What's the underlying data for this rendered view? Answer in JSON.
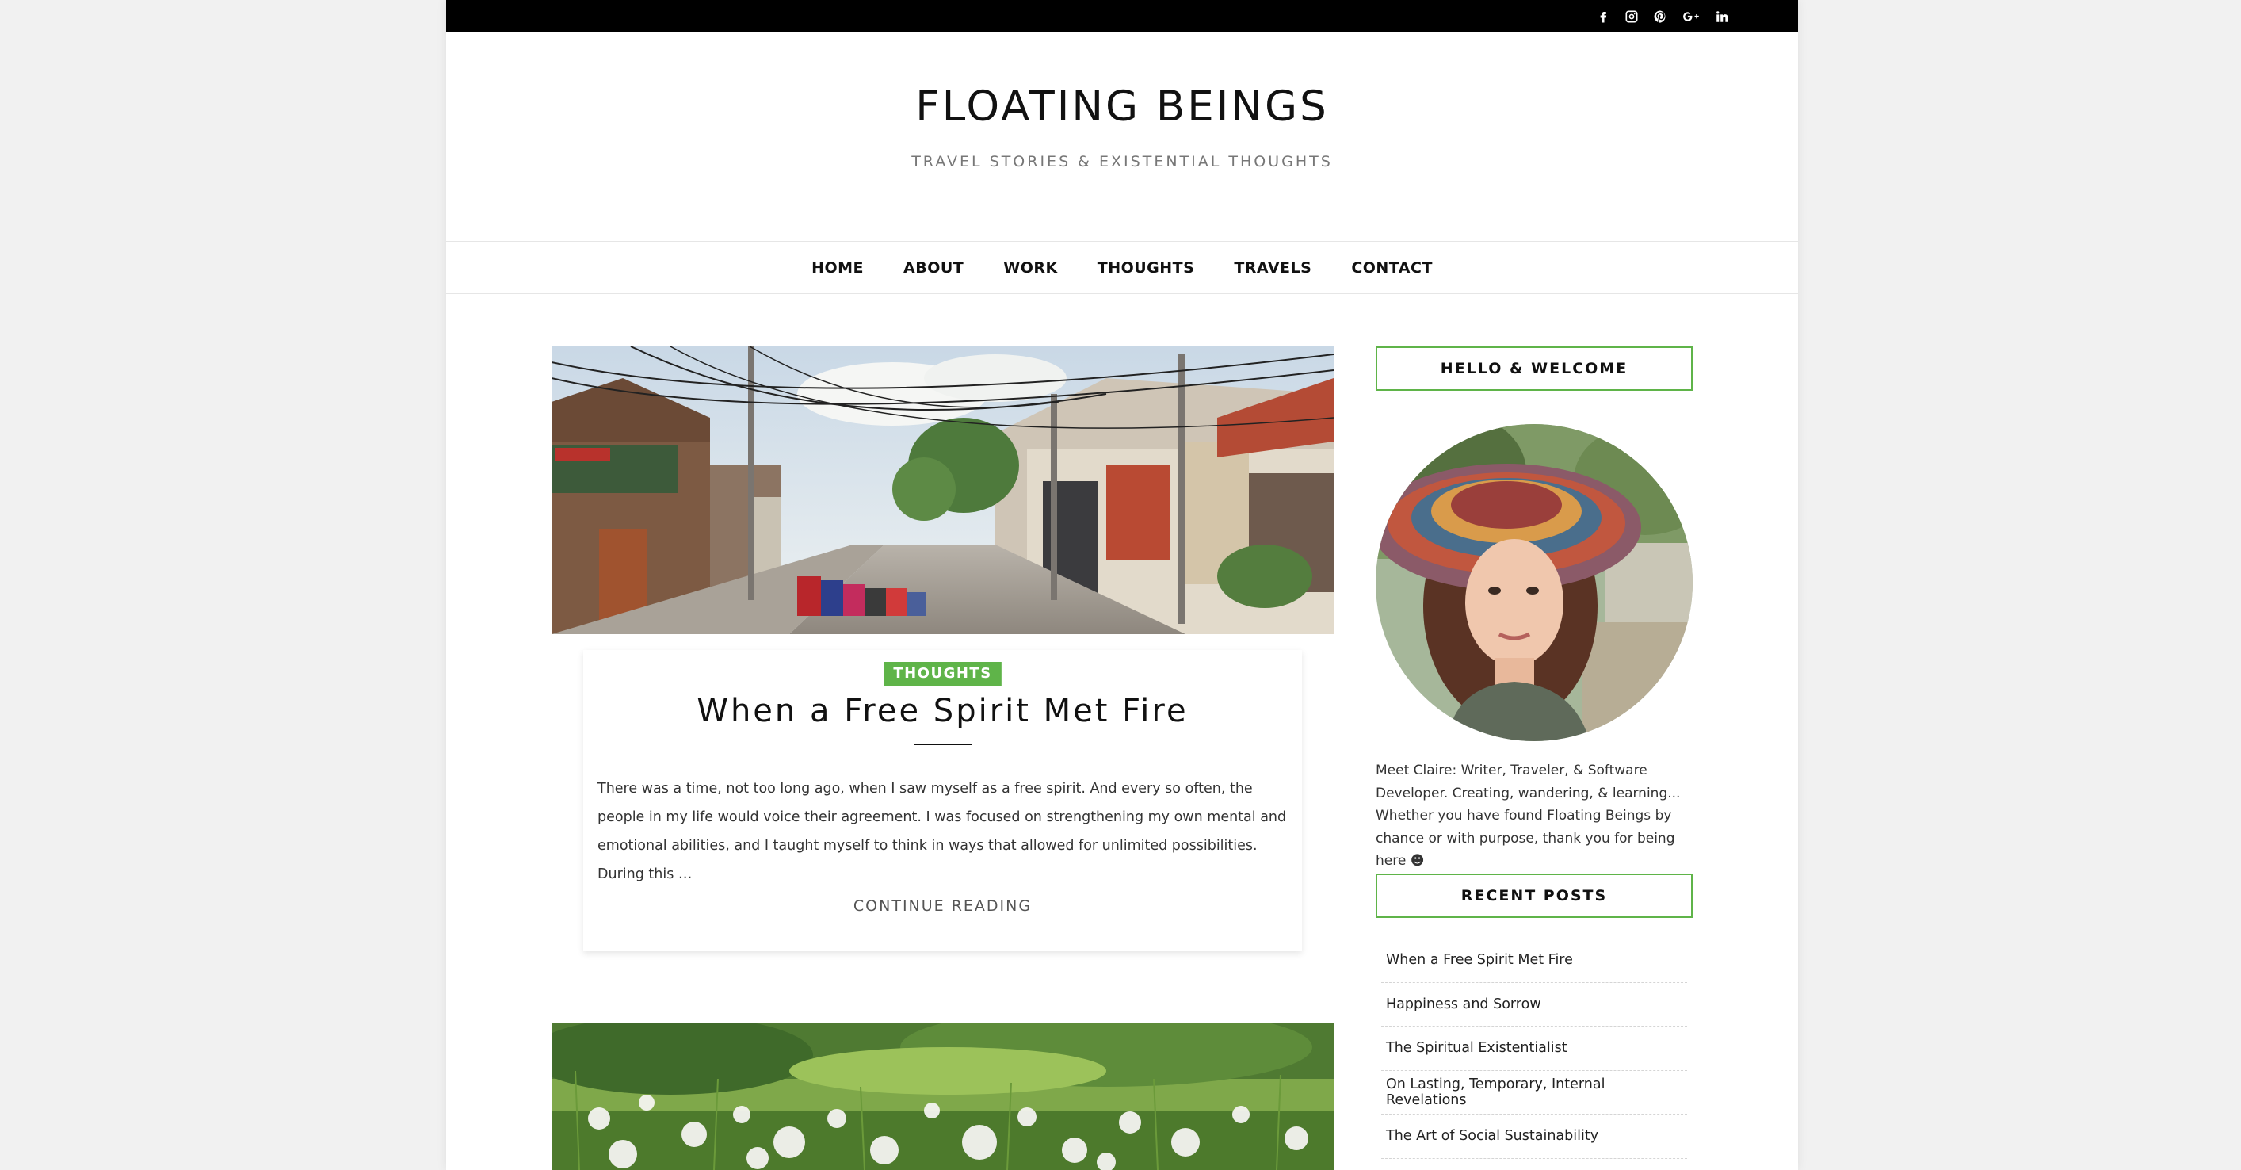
{
  "site": {
    "title": "FLOATING BEINGS",
    "tagline": "TRAVEL STORIES & EXISTENTIAL THOUGHTS"
  },
  "social": [
    {
      "icon": "facebook-icon"
    },
    {
      "icon": "instagram-icon"
    },
    {
      "icon": "pinterest-icon"
    },
    {
      "icon": "google-plus-icon"
    },
    {
      "icon": "linkedin-icon"
    }
  ],
  "nav": {
    "items": [
      {
        "label": "HOME"
      },
      {
        "label": "ABOUT"
      },
      {
        "label": "WORK"
      },
      {
        "label": "THOUGHTS"
      },
      {
        "label": "TRAVELS"
      },
      {
        "label": "CONTACT"
      }
    ]
  },
  "post": {
    "category": "THOUGHTS",
    "title": "When a Free Spirit Met Fire",
    "excerpt": "There was a time, not too long ago, when I saw myself as a free spirit. And every so often, the people in my life would voice their agreement. I was focused on strengthening my own mental and emotional abilities, and I taught myself to think in ways that allowed for unlimited possibilities. During this …",
    "continue_label": "CONTINUE READING"
  },
  "sidebar": {
    "welcome_title": "HELLO & WELCOME",
    "about_text": "Meet Claire: Writer, Traveler, & Software Developer. Creating, wandering, & learning... Whether you have found Floating Beings by chance or with purpose, thank you for being here ☻",
    "recent_title": "RECENT POSTS",
    "recent_posts": [
      {
        "title": "When a Free Spirit Met Fire"
      },
      {
        "title": "Happiness and Sorrow"
      },
      {
        "title": "The Spiritual Existentialist"
      },
      {
        "title": "On Lasting, Temporary, Internal Revelations"
      },
      {
        "title": "The Art of Social Sustainability"
      }
    ]
  },
  "colors": {
    "accent": "#5fb449",
    "topbar": "#000000",
    "background": "#f1f1f1"
  }
}
